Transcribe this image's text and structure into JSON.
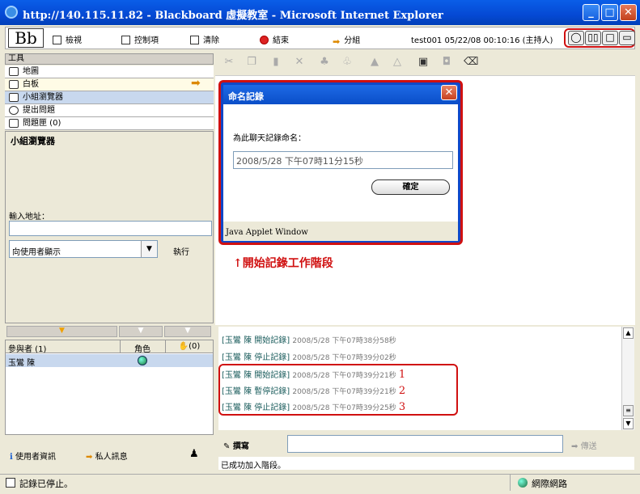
{
  "window": {
    "title": "http://140.115.11.82 - Blackboard 虛擬教室 - Microsoft Internet Explorer",
    "minimize": "_",
    "maximize": "□",
    "close": "✕"
  },
  "toolbar": {
    "logo": "Bb",
    "items": [
      {
        "label": "檢視"
      },
      {
        "label": "控制項"
      },
      {
        "label": "清除"
      },
      {
        "label": "結束"
      },
      {
        "label": "分組"
      }
    ],
    "session": "test001 05/22/08 00:10:16 (主持人)",
    "markers": [
      "1",
      "2",
      "3",
      "4"
    ]
  },
  "tools": {
    "header": "工具",
    "items": [
      {
        "label": "地圖"
      },
      {
        "label": "白板"
      },
      {
        "label": "小組瀏覽器"
      },
      {
        "label": "提出問題"
      },
      {
        "label": "問題匣 (0)"
      }
    ]
  },
  "browser": {
    "title": "小組瀏覽器",
    "address_label": "輸入地址：",
    "address_value": "",
    "target_value": "向使用者顯示",
    "run_label": "執行"
  },
  "dialog": {
    "title": "命名記錄",
    "close": "✕",
    "prompt": "為此聊天記錄命名：",
    "input_value": "2008/5/28 下午07時11分15秒",
    "ok_label": "確定",
    "footer": "Java Applet Window"
  },
  "annotation": "↑開始記錄工作階段",
  "chat": {
    "lines": [
      {
        "name": "[玉鸞 陳 開始記錄]",
        "time": "2008/5/28 下午07時38分58秒",
        "mark": ""
      },
      {
        "name": "[玉鸞 陳 停止記錄]",
        "time": "2008/5/28 下午07時39分02秒",
        "mark": ""
      },
      {
        "name": "[玉鸞 陳 開始記錄]",
        "time": "2008/5/28 下午07時39分21秒",
        "mark": "1"
      },
      {
        "name": "[玉鸞 陳 暫停記錄]",
        "time": "2008/5/28 下午07時39分21秒",
        "mark": "2"
      },
      {
        "name": "[玉鸞 陳 停止記錄]",
        "time": "2008/5/28 下午07時39分25秒",
        "mark": "3"
      }
    ],
    "send_label": "撰寫",
    "send_button": "傳送",
    "input_value": "",
    "status": "已成功加入階段。"
  },
  "participants": {
    "header": "參與者 (1)",
    "role_col": "角色",
    "hand_col": "(0)",
    "rows": [
      {
        "name": "玉鸞 陳"
      }
    ]
  },
  "bottom": {
    "user_info": "使用者資訊",
    "private_msg": "私人訊息"
  },
  "statusbar": {
    "text": "記錄已停止。",
    "zone": "網際網路"
  }
}
